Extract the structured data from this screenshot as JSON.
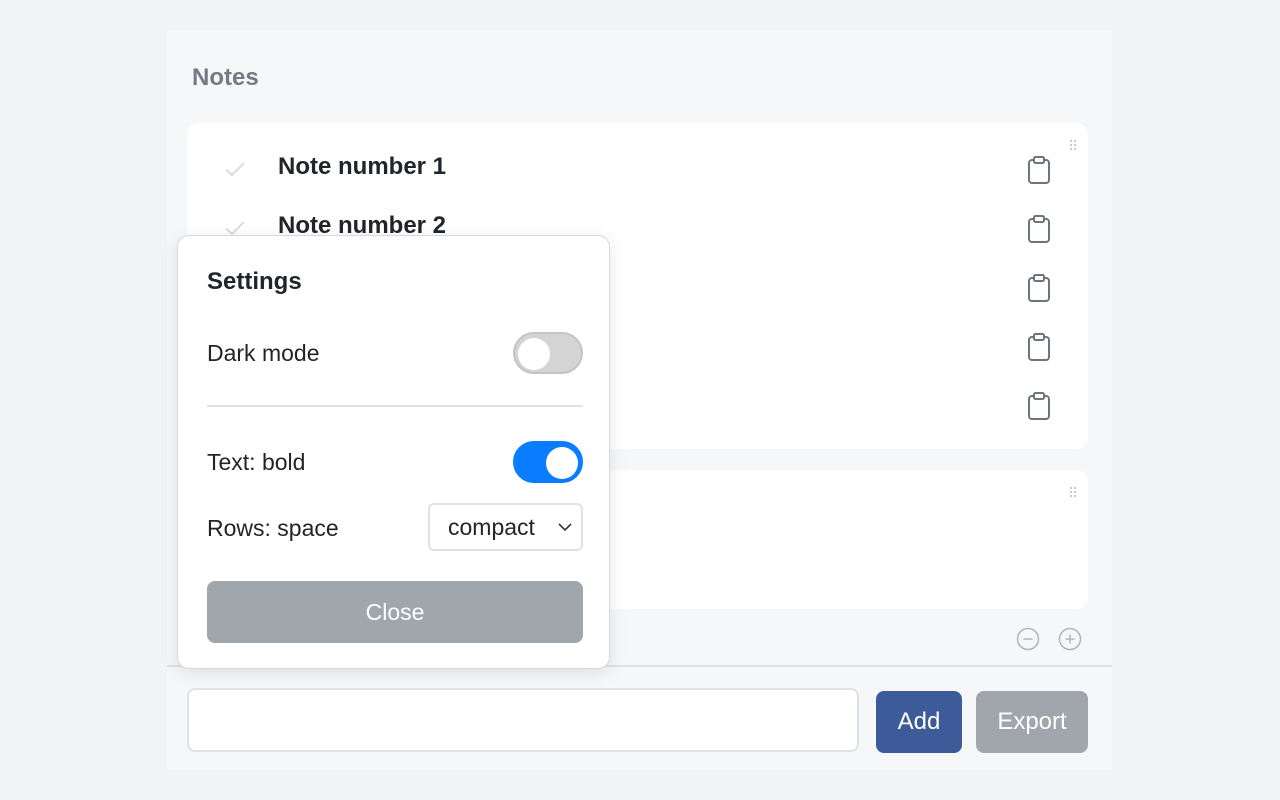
{
  "panel": {
    "title": "Notes"
  },
  "notes": [
    {
      "text": "Note number 1"
    },
    {
      "text": "Note number 2"
    },
    {
      "text": ""
    },
    {
      "text": ""
    },
    {
      "text": ""
    }
  ],
  "footer": {
    "input_value": "",
    "add_label": "Add",
    "export_label": "Export"
  },
  "settings": {
    "title": "Settings",
    "dark_mode_label": "Dark mode",
    "dark_mode_on": false,
    "text_bold_label": "Text: bold",
    "text_bold_on": true,
    "rows_space_label": "Rows: space",
    "rows_space_value": "compact",
    "close_label": "Close"
  },
  "colors": {
    "toggle_on": "#0a7cff",
    "add_button": "#3d5a99",
    "export_button": "#a0a6ab",
    "close_button": "#9fa6ac"
  },
  "icons": {
    "check": "check-icon",
    "clipboard": "clipboard-icon",
    "drag": "drag-handle-icon",
    "zoom_out": "zoom-out-icon",
    "zoom_in": "zoom-in-icon",
    "chevron": "chevron-down-icon"
  }
}
